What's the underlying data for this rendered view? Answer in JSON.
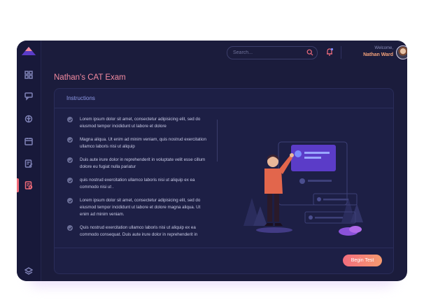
{
  "app": {
    "brand_colors": {
      "accent": "#f36d7d",
      "accent2": "#f59a6f",
      "bg": "#1b1c3c"
    }
  },
  "sidebar": {
    "items": [
      {
        "icon": "grid-icon"
      },
      {
        "icon": "chat-icon"
      },
      {
        "icon": "brain-icon"
      },
      {
        "icon": "calendar-icon"
      },
      {
        "icon": "edit-document-icon"
      },
      {
        "icon": "exam-document-icon",
        "active": true
      }
    ],
    "bottom_icon": "layers-icon"
  },
  "header": {
    "search_placeholder": "Search...",
    "welcome_label": "Welcome,",
    "user_name": "Nathan Ward"
  },
  "page": {
    "title": "Nathan's CAT Exam",
    "instructions_heading": "Instructions",
    "instructions": [
      "Lorem ipsum dolor sit amet, consectetur adipisicing elit, sed do eiusmod tempor incididunt ut labore et dolore",
      "Magna aliqua. Ut enim ad minim veniam, quis nostrud exercitation ullamco laboris nisi ut aliquip",
      "Duis aute irure dolor in reprehenderit in voluptate velit esse cillum dolore eu fugiat nulla pariatur",
      "quis nostrud exercitation ullamco laboris nisi ut aliquip ex ea commodo nisi ut .",
      "Lorem ipsum dolor sit amet, consectetur adipisicing elit, sed do eiusmod tempor incididunt ut labore et dolore magna aliqua. Ut enim ad minim veniam.",
      "Quis nostrud exercitation ullamco laboris nisi ut aliquip ex ea commodo consequat. Duis aute irure dolor in reprehenderit in"
    ],
    "begin_button": "Begin Test"
  }
}
